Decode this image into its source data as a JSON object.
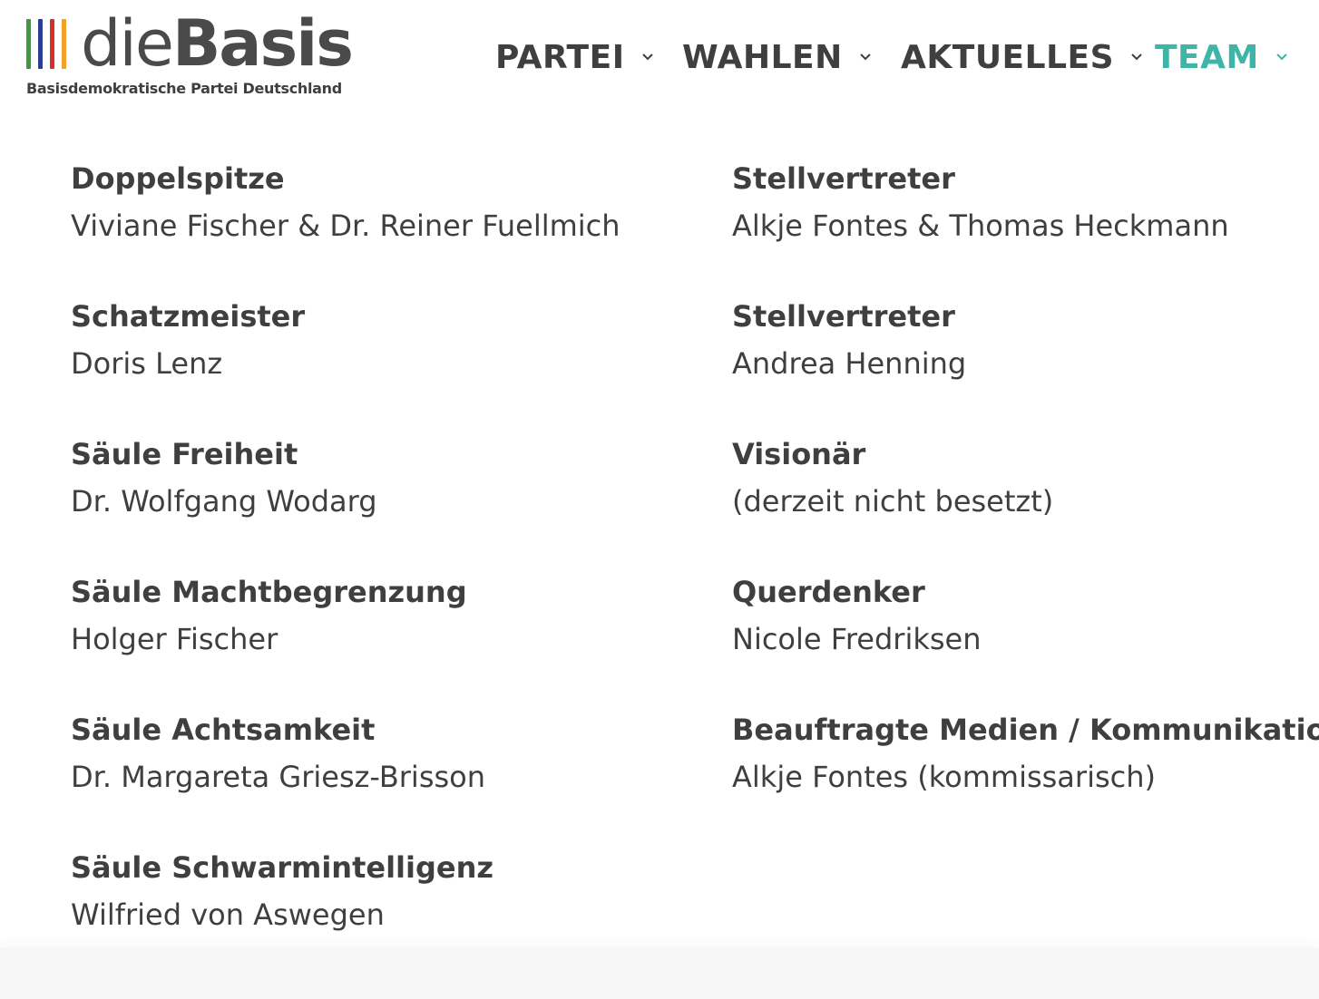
{
  "logo": {
    "word_light": "die",
    "word_bold": "Basis",
    "subtitle": "Basisdemokratische Partei Deutschland",
    "bar_colors": [
      "#3a9a3c",
      "#2a3f8f",
      "#d6302b",
      "#f2a126"
    ]
  },
  "nav": {
    "items": [
      {
        "label": "PARTEI",
        "active": false
      },
      {
        "label": "WAHLEN",
        "active": false
      },
      {
        "label": "AKTUELLES",
        "active": false
      },
      {
        "label": "TEAM",
        "active": true
      }
    ],
    "accent_color": "#3eb5a7"
  },
  "team": {
    "left": [
      {
        "role": "Doppelspitze",
        "name": "Viviane Fischer & Dr. Reiner Fuellmich"
      },
      {
        "role": "Schatzmeister",
        "name": "Doris Lenz"
      },
      {
        "role": "Säule Freiheit",
        "name": "Dr. Wolfgang Wodarg"
      },
      {
        "role": "Säule Machtbegrenzung",
        "name": "Holger Fischer"
      },
      {
        "role": "Säule Achtsamkeit",
        "name": "Dr. Margareta Griesz-Brisson"
      },
      {
        "role": "Säule Schwarmintelligenz",
        "name": "Wilfried von Aswegen"
      }
    ],
    "right": [
      {
        "role": "Stellvertreter",
        "name": "Alkje Fontes & Thomas Heckmann"
      },
      {
        "role": "Stellvertreter",
        "name": "Andrea Henning"
      },
      {
        "role": "Visionär",
        "name": "(derzeit nicht besetzt)"
      },
      {
        "role": "Querdenker",
        "name": "Nicole Fredriksen"
      },
      {
        "role": "Beauftragte Medien / Kommunikation",
        "name": "Alkje Fontes (kommissarisch)"
      }
    ]
  }
}
